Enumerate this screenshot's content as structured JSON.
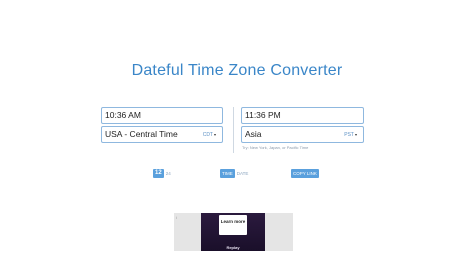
{
  "title": "Dateful Time Zone Converter",
  "left": {
    "time_value": "10:36 AM",
    "zone_value": "USA - Central Time",
    "zone_abbr": "CDT"
  },
  "right": {
    "time_value": "11:36 PM",
    "zone_value": "Asia",
    "zone_abbr": "PST",
    "hint": "Try: New York, Japan, or Pacific Time"
  },
  "controls": {
    "format_active": "12",
    "format_inactive": "24",
    "time_label": "TIME",
    "date_label": "DATE",
    "copy_label": "COPY LINK"
  },
  "ad": {
    "info_glyph": "i",
    "learn_label": "Learn more",
    "replay_label": "Replay"
  },
  "colors": {
    "accent": "#3a86c8",
    "field_border": "#8fb8df",
    "pill": "#5aa0dd"
  }
}
